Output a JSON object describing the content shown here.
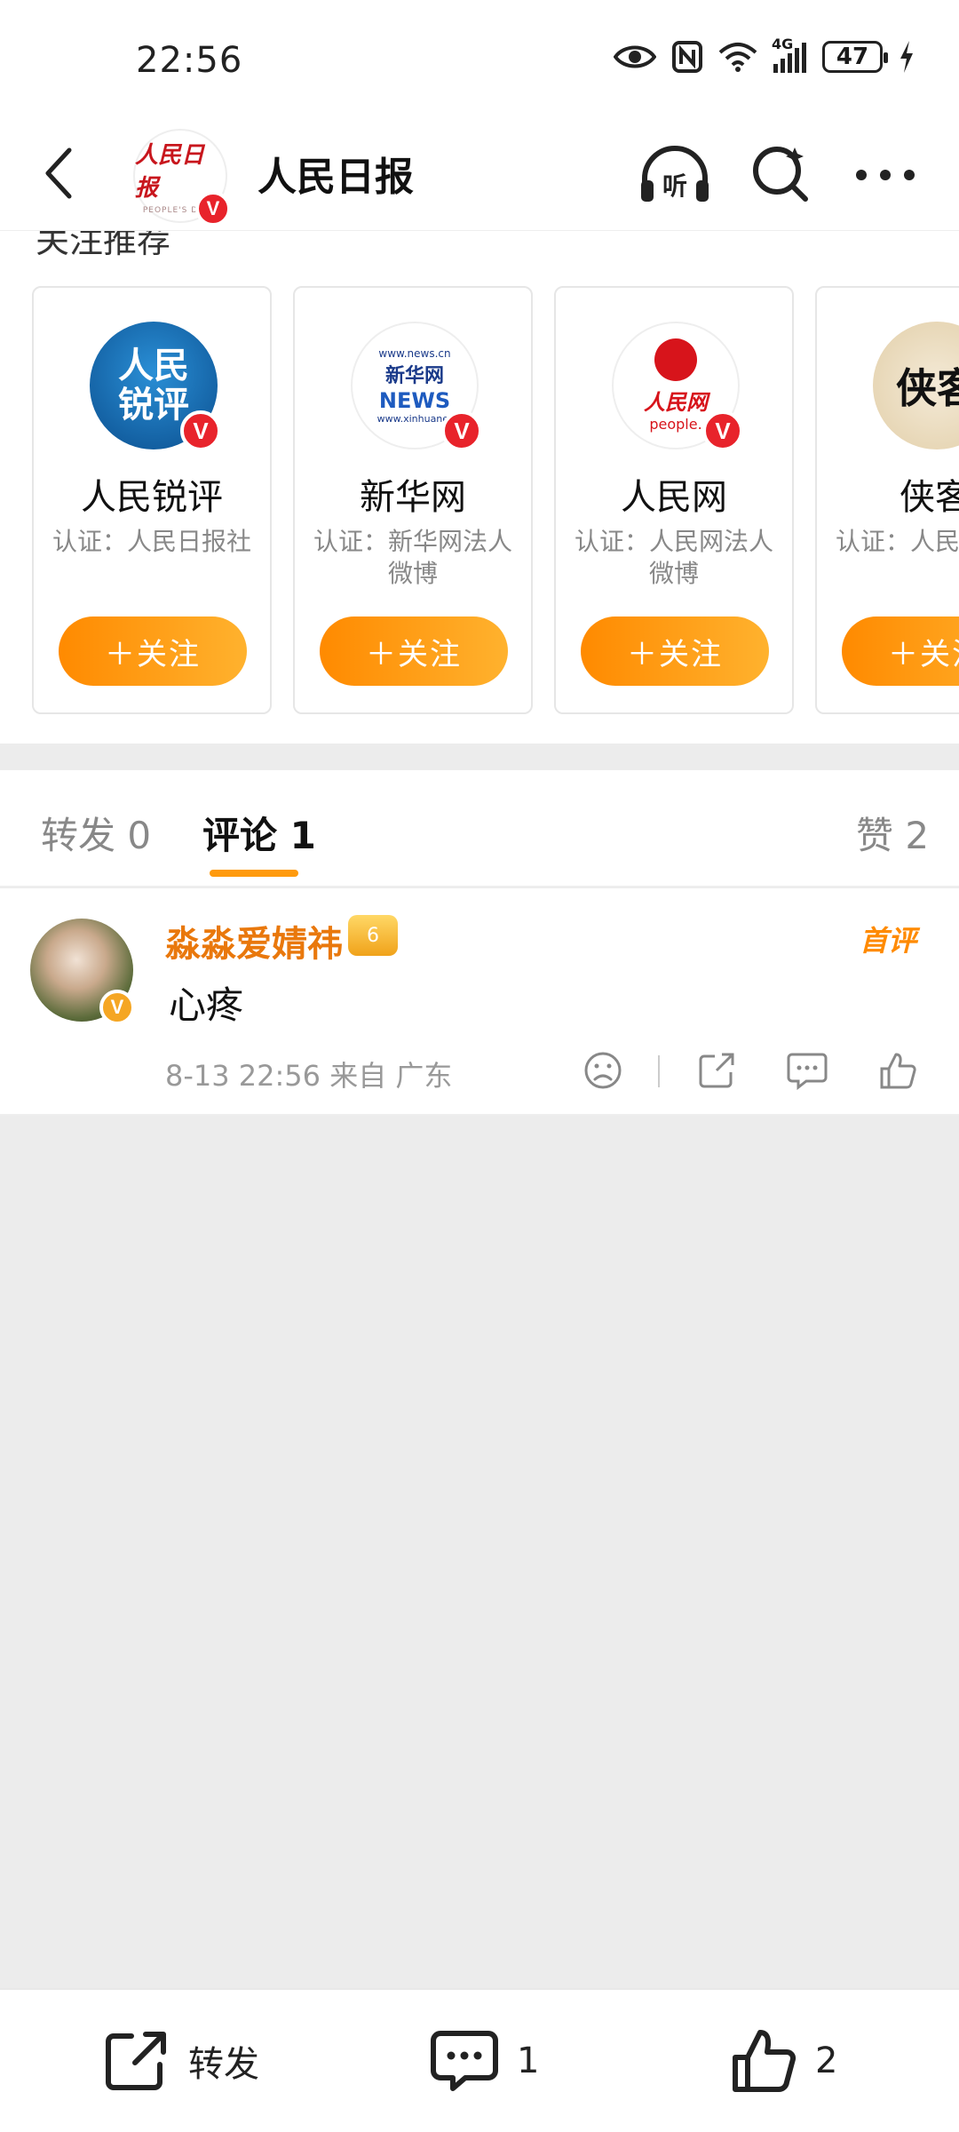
{
  "status_bar": {
    "time": "22:56",
    "network": "4G",
    "battery": "47",
    "icons": [
      "eye-icon",
      "nfc-icon",
      "wifi-icon",
      "signal-icon",
      "battery-icon",
      "charging-icon"
    ]
  },
  "header": {
    "title": "人民日报",
    "avatar_logo": "人民日报",
    "avatar_logo_en": "PEOPLE'S DAILY",
    "verified_badge": "V"
  },
  "recommendations": {
    "title": "关注推荐",
    "cards": [
      {
        "name": "人民锐评",
        "cert": "认证：人民日报社",
        "follow": "＋关注",
        "logo_line1": "人民",
        "logo_line2": "锐评"
      },
      {
        "name": "新华网",
        "cert": "认证：新华网法人微博",
        "follow": "＋关注",
        "logo_top": "www.news.cn",
        "logo_mid": "新华网",
        "logo_news": "NEWS",
        "logo_bottom": "www.xinhuanet"
      },
      {
        "name": "人民网",
        "cert": "认证：人民网法人微博",
        "follow": "＋关注",
        "logo_cn": "人民网",
        "logo_en": "people."
      },
      {
        "name": "侠客",
        "cert": "认证：人民日报社",
        "follow": "＋关注",
        "logo": "侠客"
      }
    ]
  },
  "tabs": [
    {
      "label": "转发 0"
    },
    {
      "label": "评论 1"
    },
    {
      "label": "赞 2"
    }
  ],
  "comment": {
    "user": "淼淼爱婧祎",
    "level_badge": "6",
    "first_tag": "首评",
    "text": "心疼",
    "meta": "8-13 22:56 来自 广东"
  },
  "bottom_bar": {
    "repost_label": "转发",
    "comment_count": "1",
    "like_count": "2"
  }
}
